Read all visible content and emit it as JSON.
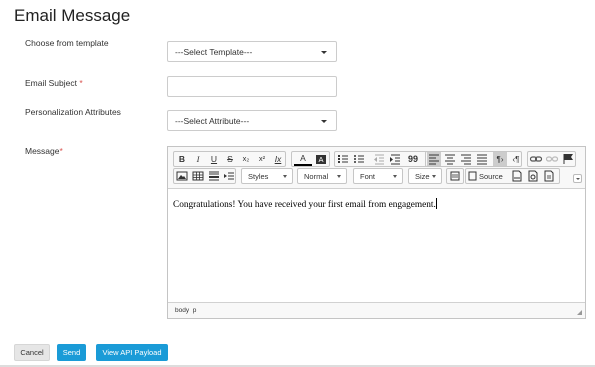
{
  "page": {
    "title": "Email Message"
  },
  "form": {
    "template": {
      "label": "Choose from template",
      "value": "---Select Template---"
    },
    "subject": {
      "label": "Email Subject",
      "required_mark": "*",
      "value": ""
    },
    "personalization": {
      "label": "Personalization Attributes",
      "value": "---Select Attribute---"
    },
    "message": {
      "label": "Message",
      "required_mark": "*"
    }
  },
  "editor": {
    "toolbar_row1": {
      "bold": "B",
      "italic": "I",
      "underline": "U",
      "strike": "S",
      "subscript": "x₂",
      "superscript": "x²",
      "remove_format": "Ix",
      "text_color": "A",
      "bg_color": "A",
      "blockquote": "99"
    },
    "toolbar_row2": {
      "styles": "Styles",
      "format": "Normal",
      "font": "Font",
      "size": "Size",
      "source": "Source"
    },
    "content": "Congratulations! You have received your first email from engagement.",
    "status_path": "body  p"
  },
  "buttons": {
    "cancel": "Cancel",
    "send": "Send",
    "api": "View API Payload"
  },
  "colors": {
    "primary": "#1a9bd7",
    "required": "#d9534f"
  }
}
